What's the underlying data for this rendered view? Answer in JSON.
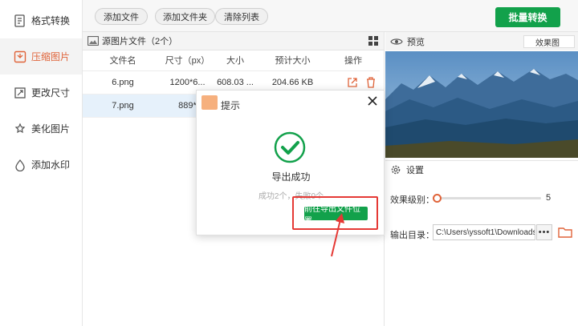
{
  "sidebar": {
    "items": [
      {
        "label": "格式转换",
        "icon": "format-convert-icon"
      },
      {
        "label": "压缩图片",
        "icon": "compress-icon"
      },
      {
        "label": "更改尺寸",
        "icon": "resize-icon"
      },
      {
        "label": "美化图片",
        "icon": "beautify-icon"
      },
      {
        "label": "添加水印",
        "icon": "watermark-icon"
      }
    ],
    "active_index": 1
  },
  "toolbar": {
    "add_file": "添加文件",
    "add_folder": "添加文件夹",
    "clear_list": "清除列表",
    "batch_convert": "批量转换"
  },
  "file_panel": {
    "title": "源图片文件（2个）",
    "columns": [
      "文件名",
      "尺寸（px）",
      "大小",
      "预计大小",
      "操作"
    ],
    "rows": [
      {
        "name": "6.png",
        "dims": "1200*6...",
        "size": "608.03 ...",
        "est": "204.66 KB"
      },
      {
        "name": "7.png",
        "dims": "889*",
        "size": "",
        "est": ""
      }
    ]
  },
  "preview": {
    "title": "预览",
    "effect_select": "效果图"
  },
  "settings": {
    "title": "设置",
    "level_label": "效果级别：",
    "level_value": "5",
    "output_label": "输出目录：",
    "output_path": "C:\\Users\\yssoft1\\Downloads",
    "browse_dots": "•••"
  },
  "dialog": {
    "title": "提示",
    "message": "导出成功",
    "sub": "成功2个，失败0个",
    "button": "前往导出文件位置"
  },
  "colors": {
    "accent": "#e0643a",
    "green": "#12a14b",
    "highlight": "#e53935"
  }
}
